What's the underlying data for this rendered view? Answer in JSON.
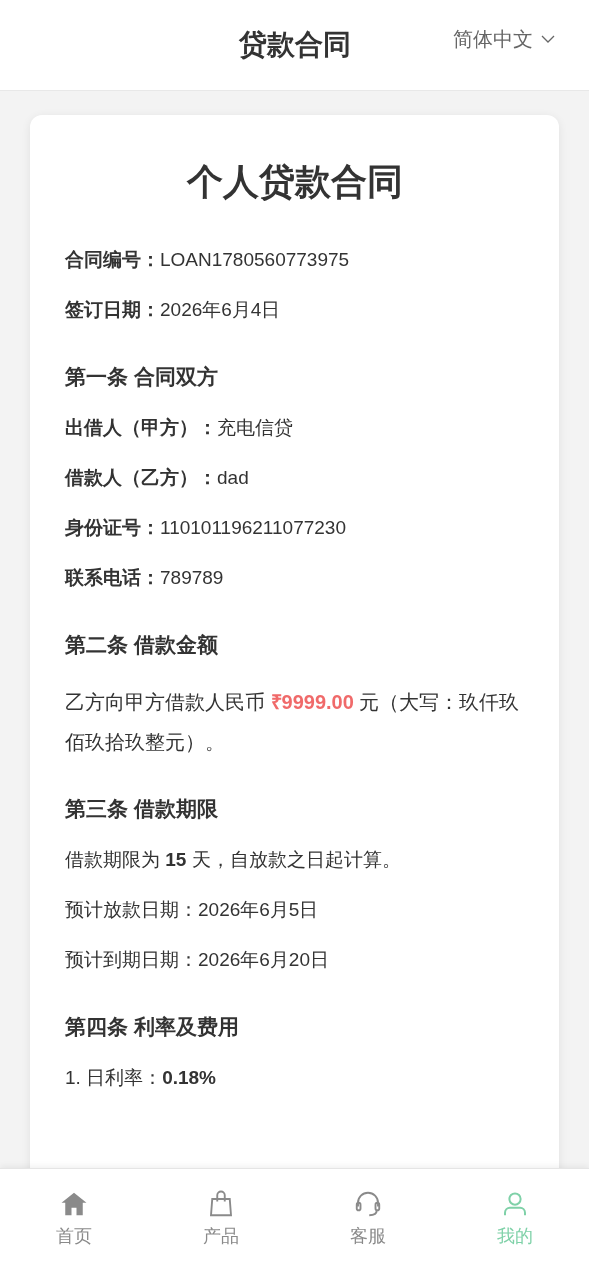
{
  "header": {
    "title": "贷款合同",
    "language": "简体中文"
  },
  "contract": {
    "title": "个人贷款合同",
    "blocks": [
      {
        "kind": "field",
        "label": "合同编号：",
        "value": "LOAN1780560773975"
      },
      {
        "kind": "field",
        "label": "签订日期：",
        "value": "2026年6月4日"
      },
      {
        "kind": "heading",
        "text": "第一条 合同双方"
      },
      {
        "kind": "field",
        "label": "出借人（甲方）：",
        "value": "充电信贷"
      },
      {
        "kind": "field",
        "label": "借款人（乙方）：",
        "value": "dad"
      },
      {
        "kind": "field",
        "label": "身份证号：",
        "value": "110101196211077230"
      },
      {
        "kind": "field",
        "label": "联系电话：",
        "value": "789789"
      },
      {
        "kind": "heading",
        "text": "第二条 借款金额"
      },
      {
        "kind": "amount",
        "before": "乙方向甲方借款人民币 ",
        "amount": "₹9999.00",
        "after": " 元（大写：玖仟玖佰玖拾玖整元）。"
      },
      {
        "kind": "heading",
        "text": "第三条 借款期限"
      },
      {
        "kind": "text",
        "text": "借款期限为 **15** 天，自放款之日起计算。"
      },
      {
        "kind": "text",
        "text": "预计放款日期：2026年6月5日"
      },
      {
        "kind": "text",
        "text": "预计到期日期：2026年6月20日"
      },
      {
        "kind": "heading",
        "text": "第四条 利率及费用"
      },
      {
        "kind": "text",
        "text": "1. 日利率：**0.18%**"
      }
    ]
  },
  "nav": [
    {
      "label": "首页",
      "kind": "home",
      "selected": false
    },
    {
      "label": "产品",
      "kind": "bag",
      "selected": false
    },
    {
      "label": "客服",
      "kind": "headset",
      "selected": false
    },
    {
      "label": "我的",
      "kind": "user",
      "selected": true
    }
  ]
}
